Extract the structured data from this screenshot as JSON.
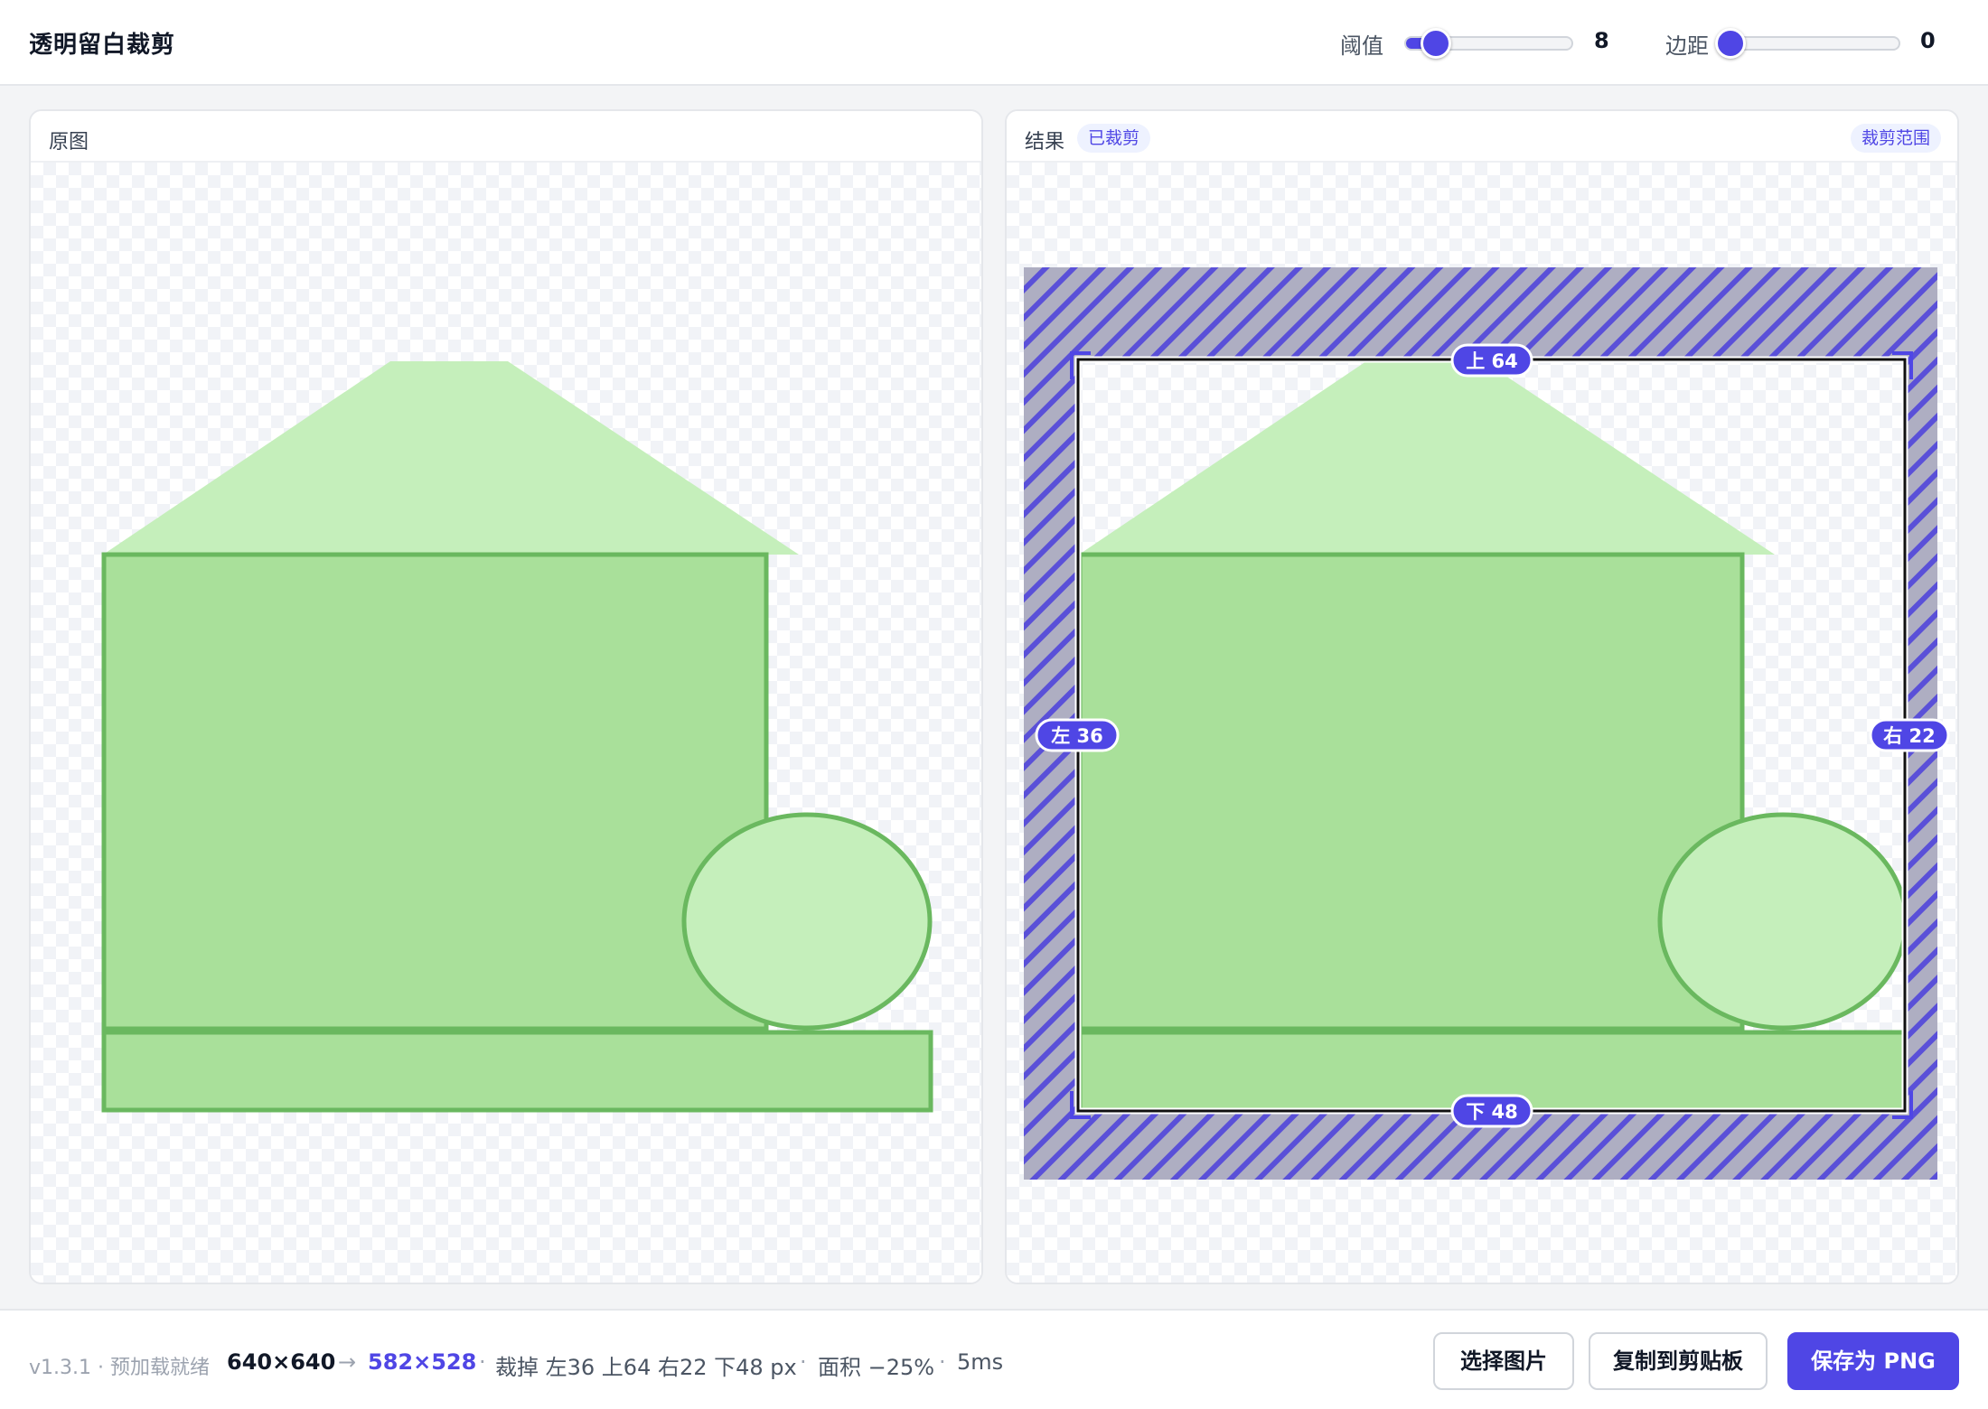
{
  "app": {
    "title": "透明留白裁剪"
  },
  "controls": {
    "threshold": {
      "label": "阈值",
      "value": "8",
      "fraction": 0.18
    },
    "margin": {
      "label": "边距",
      "value": "0",
      "fraction": 0.0
    }
  },
  "panels": {
    "original": {
      "title": "原图"
    },
    "result": {
      "title": "结果",
      "status_badge": "已裁剪",
      "toggle_label": "裁剪范围"
    }
  },
  "crop_tags": {
    "top": "上 64",
    "left": "左 36",
    "right": "右 22",
    "bottom": "下 48"
  },
  "footer": {
    "version": "v1.3.1 · 预加载就绪",
    "source_size": "640×640",
    "arrow": "→",
    "result_size": "582×528",
    "sep": "·",
    "crop_summary": "裁掉 左36 上64 右22 下48 px",
    "area": "面积 −25%",
    "time": "5ms"
  },
  "buttons": {
    "choose": "选择图片",
    "copy": "复制到剪贴板",
    "save": "保存为 PNG"
  },
  "colors": {
    "accent": "#4f46e5",
    "shape_fill": "#a9e09a",
    "shape_light": "#c5efbb",
    "shape_stroke": "#6ab85f",
    "hatch": "#5a50d8"
  }
}
